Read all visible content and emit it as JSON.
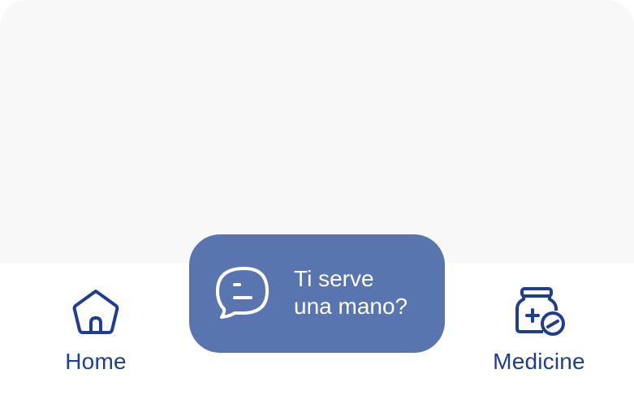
{
  "tab_bar": {
    "home_label": "Home",
    "medicine_label": "Medicine"
  },
  "help": {
    "line1": "Ti serve",
    "line2": "una mano?"
  },
  "icons": {
    "home": "home-icon",
    "medicine": "medicine-jar-icon",
    "help": "chat-bubble-icon"
  },
  "colors": {
    "accent": "#1f3e8f",
    "help_button": "#5875b0",
    "content_background": "#f8f8f9"
  }
}
